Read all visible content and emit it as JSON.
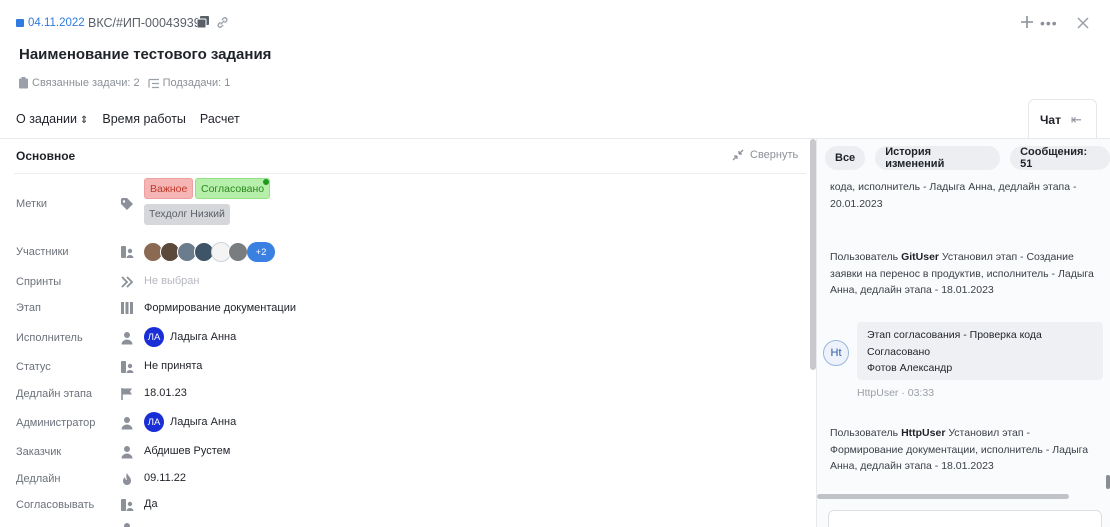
{
  "header": {
    "date": "04.11.2022",
    "task_id": "ВКС/#ИП-00043939",
    "title": "Наименование тестового задания",
    "related_tasks": "Связанные задачи: 2",
    "subtasks": "Подзадачи: 1"
  },
  "tabs": [
    {
      "label": "О задании",
      "chevron": "⌃⌄"
    },
    {
      "label": "Время работы"
    },
    {
      "label": "Расчет"
    }
  ],
  "chat_tab": {
    "label": "Чат",
    "collapse_glyph": "⇤"
  },
  "section": {
    "title": "Основное",
    "collapse_label": "Свернуть"
  },
  "fields": {
    "tags": {
      "label": "Метки",
      "items": [
        "Важное",
        "Согласовано",
        "Техдолг Низкий"
      ]
    },
    "participants": {
      "label": "Участники",
      "extra": "+2"
    },
    "sprints": {
      "label": "Спринты",
      "value": "Не выбран"
    },
    "stage": {
      "label": "Этап",
      "value": "Формирование документации"
    },
    "executor": {
      "label": "Исполнитель",
      "initials": "ЛА",
      "value": "Ладыга Анна"
    },
    "status": {
      "label": "Статус",
      "value": "Не принята"
    },
    "stage_deadline": {
      "label": "Дедлайн этапа",
      "value": "18.01.23"
    },
    "admin": {
      "label": "Администратор",
      "initials": "ЛА",
      "value": "Ладыга Анна"
    },
    "customer": {
      "label": "Заказчик",
      "value": "Абдишев Рустем"
    },
    "deadline": {
      "label": "Дедлайн",
      "value": "09.11.22"
    },
    "approve": {
      "label": "Согласовывать",
      "value": "Да"
    }
  },
  "chat": {
    "filters": [
      "Все",
      "История изменений",
      "Сообщения: 51"
    ],
    "log1": "кода, исполнитель - Ладыга Анна, дедлайн этапа - 20.01.2023",
    "log2_prefix": "Пользователь",
    "log2_user": "GitUser",
    "log2_text": "Установил этап - Создание заявки на перенос в продуктив, исполнитель - Ладыга Анна, дедлайн этапа - 18.01.2023",
    "message": {
      "avatar": "Ht",
      "line1": "Этап согласования - Проверка кода",
      "line2": "Согласовано",
      "line3": "Фотов Александр",
      "meta": "HttpUser · 03:33"
    },
    "log3_prefix": "Пользователь",
    "log3_user": "HttpUser",
    "log3_text": "Установил этап - Формирование документации, исполнитель - Ладыга Анна, дедлайн этапа - 18.01.2023"
  },
  "colors": {
    "accent": "#2f7be0",
    "avatar_blue": "#1a2ed6",
    "tag_red": "#f5b5b5",
    "tag_green": "#b5efaa",
    "tag_gray": "#d5d7da"
  }
}
